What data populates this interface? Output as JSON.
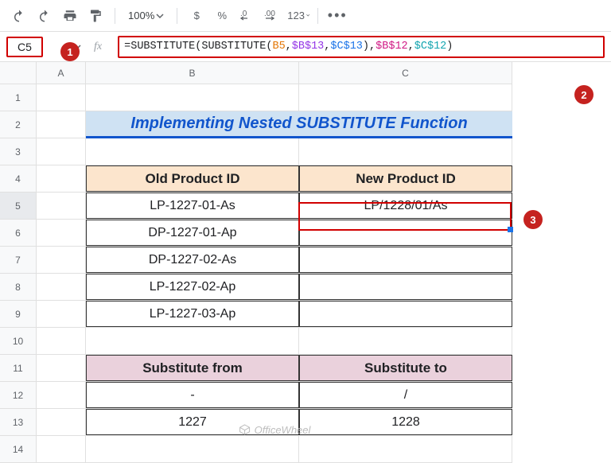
{
  "toolbar": {
    "zoom": "100%",
    "currency": "$",
    "percent": "%",
    "dec_less": ".0",
    "dec_more": ".00",
    "num_fmt": "123"
  },
  "formula_row": {
    "name_box": "C5",
    "fx": "fx"
  },
  "formula": {
    "eq": "=",
    "fn": "SUBSTITUTE",
    "op": "(",
    "cp": ")",
    "comma": ",",
    "ref_b5": "B5",
    "ref_b13": "$B$13",
    "ref_c13": "$C$13",
    "ref_b12": "$B$12",
    "ref_c12": "$C$12"
  },
  "columns": {
    "A": "A",
    "B": "B",
    "C": "C"
  },
  "rows": [
    "1",
    "2",
    "3",
    "4",
    "5",
    "6",
    "7",
    "8",
    "9",
    "10",
    "11",
    "12",
    "13",
    "14"
  ],
  "title": "Implementing Nested SUBSTITUTE Function",
  "headers": {
    "old_id": "Old Product ID",
    "new_id": "New Product ID",
    "sub_from": "Substitute from",
    "sub_to": "Substitute to"
  },
  "old_ids": [
    "LP-1227-01-As",
    "DP-1227-01-Ap",
    "DP-1227-02-As",
    "LP-1227-02-Ap",
    "LP-1227-03-Ap"
  ],
  "new_ids": [
    "LP/1228/01/As",
    "",
    "",
    "",
    ""
  ],
  "sub": {
    "from1": "-",
    "to1": "/",
    "from2": "1227",
    "to2": "1228"
  },
  "annotations": {
    "m1": "1",
    "m2": "2",
    "m3": "3"
  },
  "watermark": "OfficeWheel"
}
